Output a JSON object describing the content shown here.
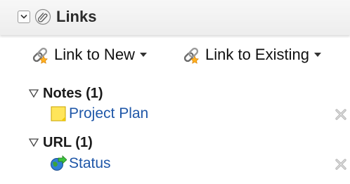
{
  "header": {
    "title": "Links"
  },
  "toolbar": {
    "link_new_label": "Link to New",
    "link_existing_label": "Link to Existing"
  },
  "groups": [
    {
      "title": "Notes (1)",
      "items": [
        {
          "label": "Project Plan",
          "icon": "note-icon"
        }
      ]
    },
    {
      "title": "URL (1)",
      "items": [
        {
          "label": "Status",
          "icon": "url-globe-icon"
        }
      ]
    }
  ],
  "colors": {
    "link_text": "#1f57a8",
    "header_bg": "#ededed",
    "note_yellow": "#ffe55a"
  }
}
